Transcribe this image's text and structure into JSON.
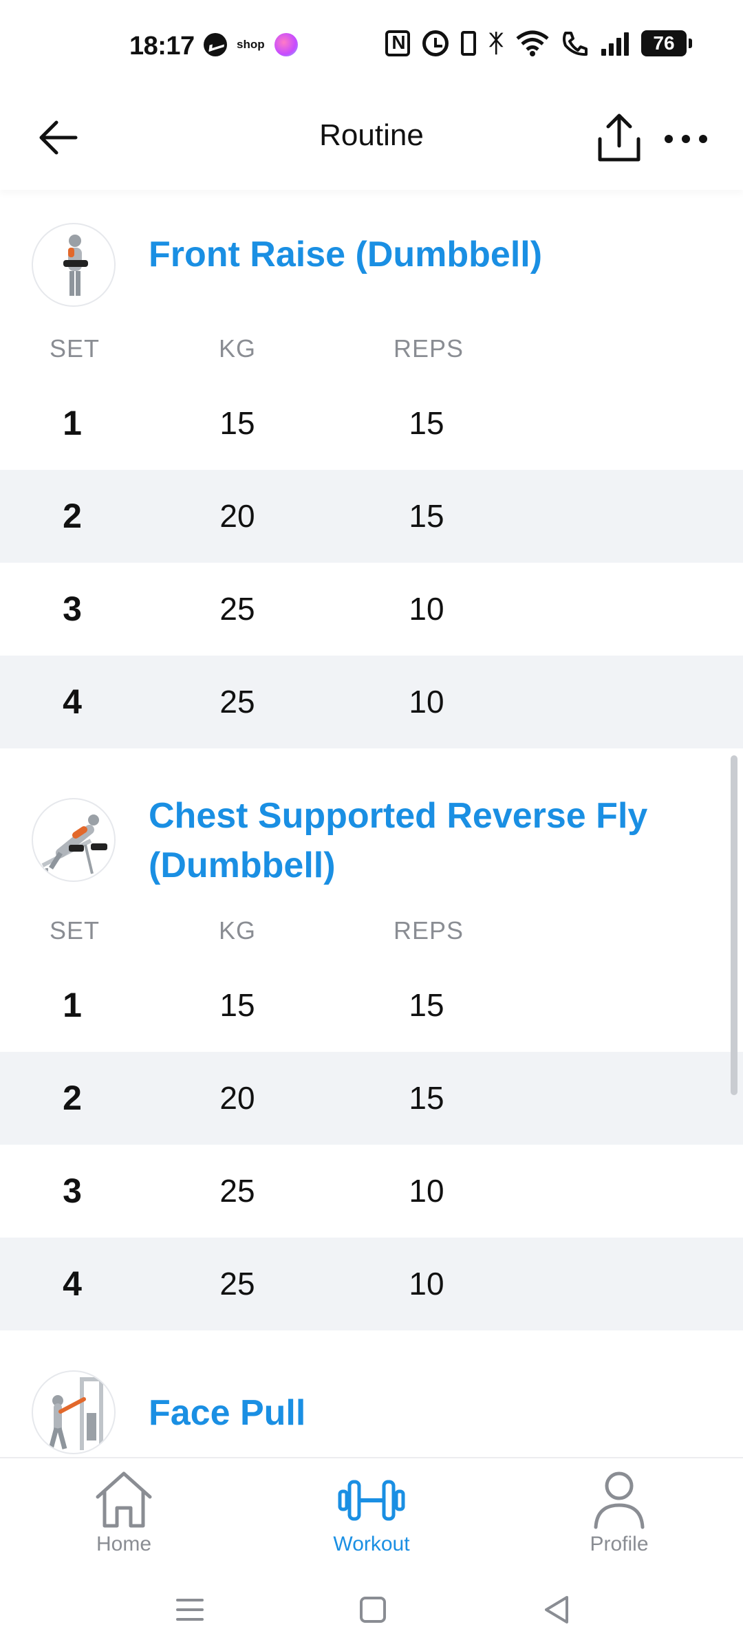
{
  "status_bar": {
    "time": "18:17",
    "shop_label": "shop",
    "battery_level": "76",
    "icons": [
      "messenger-icon",
      "shop-icon",
      "app-notification-icon",
      "nfc-icon",
      "alarm-icon",
      "vibrate-icon",
      "bluetooth-icon",
      "wifi-icon",
      "wifi-call-icon",
      "signal-icon",
      "battery-icon"
    ]
  },
  "header": {
    "title": "Routine",
    "back_icon": "arrow-left-icon",
    "share_icon": "share-icon",
    "more_icon": "more-horizontal-icon"
  },
  "exercises": [
    {
      "name": "Front Raise (Dumbbell)",
      "columns": {
        "set": "SET",
        "kg": "KG",
        "reps": "REPS"
      },
      "sets": [
        {
          "set": "1",
          "kg": "15",
          "reps": "15"
        },
        {
          "set": "2",
          "kg": "20",
          "reps": "15"
        },
        {
          "set": "3",
          "kg": "25",
          "reps": "10"
        },
        {
          "set": "4",
          "kg": "25",
          "reps": "10"
        }
      ]
    },
    {
      "name": "Chest Supported Reverse Fly (Dumbbell)",
      "columns": {
        "set": "SET",
        "kg": "KG",
        "reps": "REPS"
      },
      "sets": [
        {
          "set": "1",
          "kg": "15",
          "reps": "15"
        },
        {
          "set": "2",
          "kg": "20",
          "reps": "15"
        },
        {
          "set": "3",
          "kg": "25",
          "reps": "10"
        },
        {
          "set": "4",
          "kg": "25",
          "reps": "10"
        }
      ]
    },
    {
      "name": "Face Pull"
    }
  ],
  "bottom_nav": {
    "items": [
      {
        "label": "Home",
        "icon": "home-icon",
        "active": false
      },
      {
        "label": "Workout",
        "icon": "dumbbell-icon",
        "active": true
      },
      {
        "label": "Profile",
        "icon": "profile-icon",
        "active": false
      }
    ]
  },
  "system_nav": {
    "icons": [
      "menu-icon",
      "home-square-icon",
      "back-triangle-icon"
    ]
  },
  "colors": {
    "accent": "#1a8fe3",
    "row_shade": "#f1f3f6",
    "muted_text": "#8a8d93"
  }
}
